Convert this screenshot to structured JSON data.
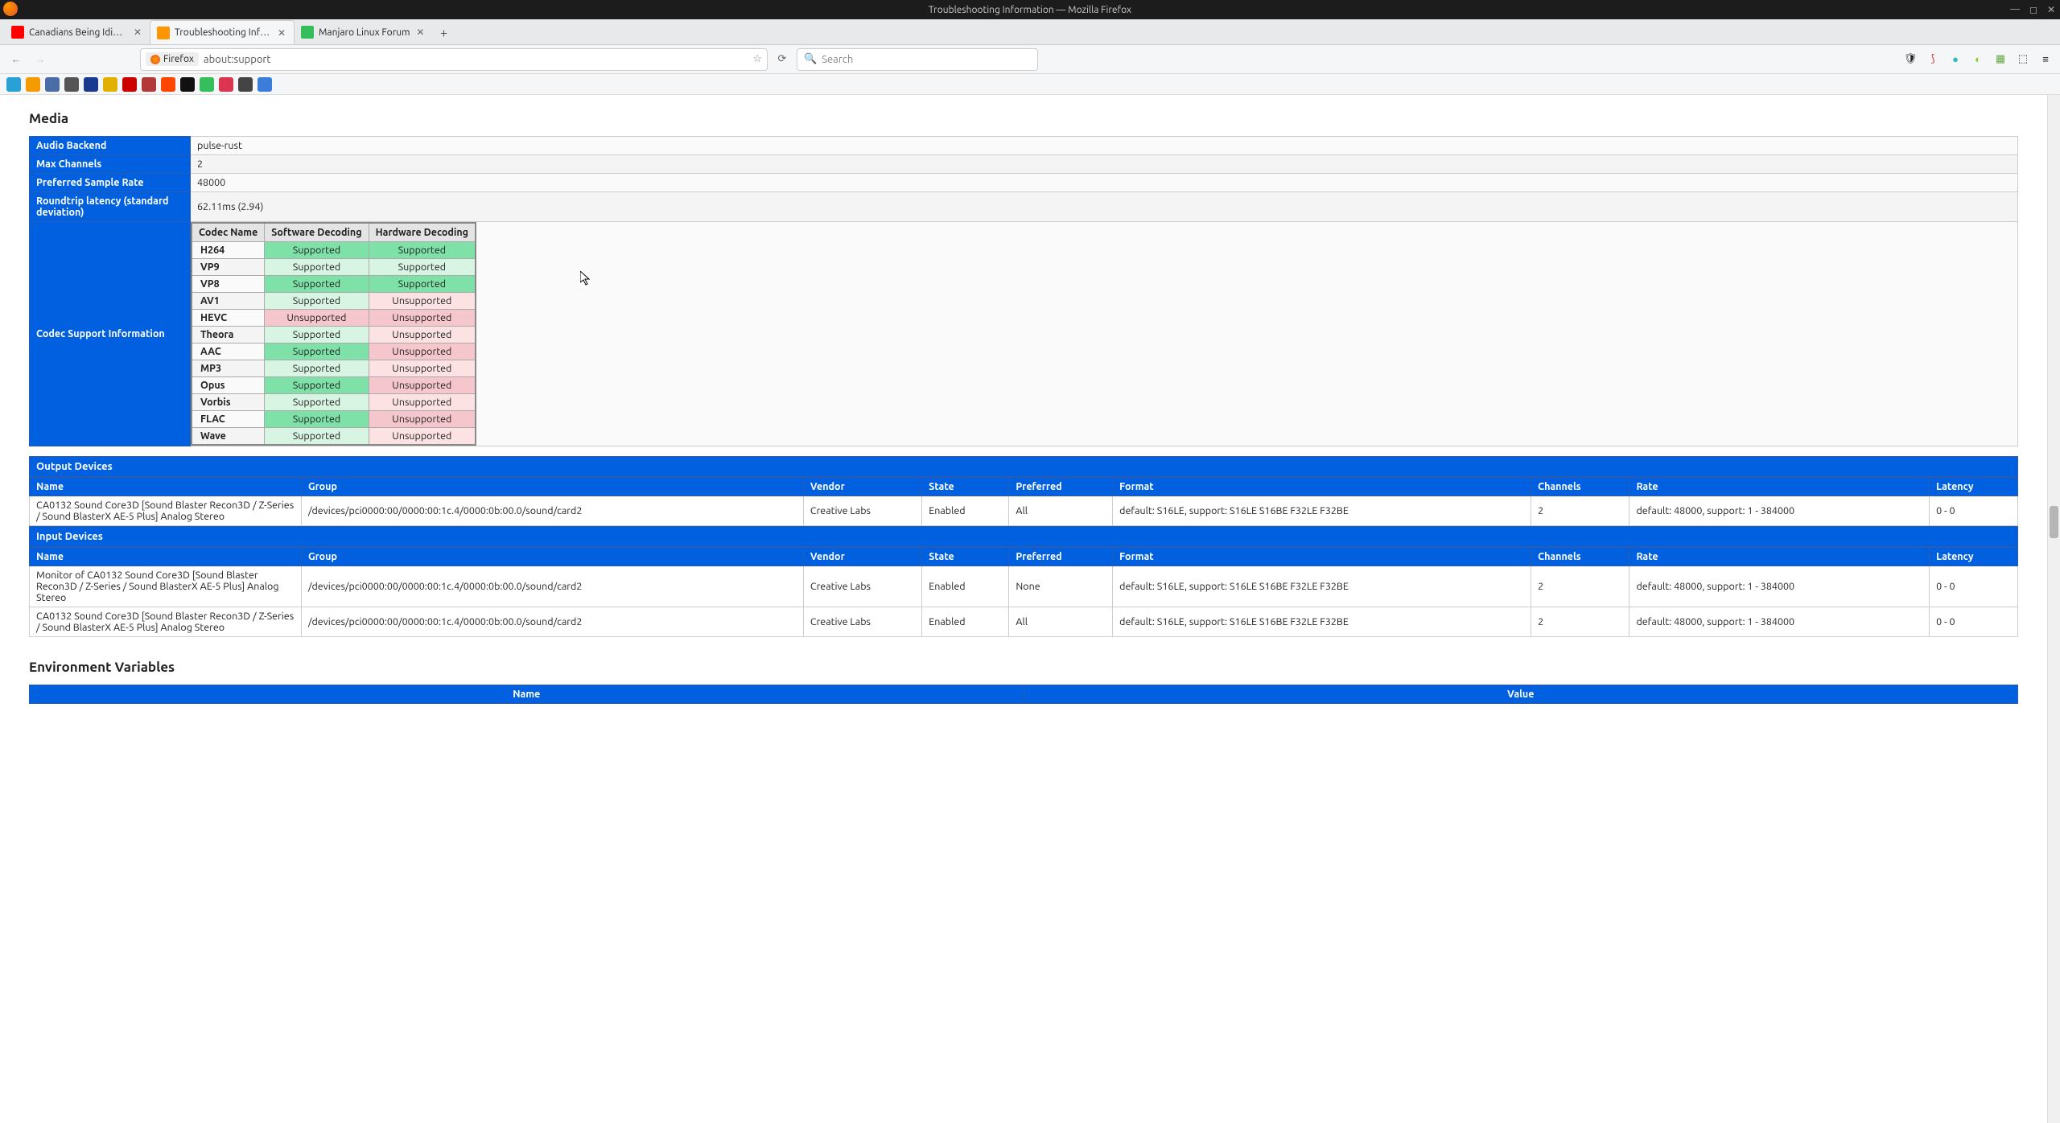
{
  "window_title": "Troubleshooting Information — Mozilla Firefox",
  "tabs": [
    {
      "label": "Canadians Being Idiots | F",
      "favicon_color": "#ff0000"
    },
    {
      "label": "Troubleshooting Informati",
      "favicon_color": "#ff9500",
      "active": true
    },
    {
      "label": "Manjaro Linux Forum",
      "favicon_color": "#35bf5c"
    }
  ],
  "urlbar": {
    "identity": "Firefox",
    "url": "about:support"
  },
  "searchbar": {
    "placeholder": "Search"
  },
  "bookmarks": [
    {
      "color": "#2aa1d6"
    },
    {
      "color": "#f59b00"
    },
    {
      "color": "#4a6da7"
    },
    {
      "color": "#555"
    },
    {
      "color": "#1a3a8f"
    },
    {
      "color": "#e2b100"
    },
    {
      "color": "#c00"
    },
    {
      "color": "#b33939"
    },
    {
      "color": "#ff4500"
    },
    {
      "color": "#111"
    },
    {
      "color": "#35bf5c"
    },
    {
      "color": "#db3552"
    },
    {
      "color": "#444"
    },
    {
      "color": "#3b7dd8"
    }
  ],
  "media": {
    "heading": "Media",
    "rows": {
      "audio_backend_label": "Audio Backend",
      "audio_backend_value": "pulse-rust",
      "max_channels_label": "Max Channels",
      "max_channels_value": "2",
      "sample_rate_label": "Preferred Sample Rate",
      "sample_rate_value": "48000",
      "latency_label": "Roundtrip latency (standard deviation)",
      "latency_value": "62.11ms (2.94)",
      "codec_label": "Codec Support Information"
    },
    "codec_headers": {
      "name": "Codec Name",
      "sw": "Software Decoding",
      "hw": "Hardware Decoding"
    },
    "codecs": [
      {
        "name": "H264",
        "sw": "Supported",
        "hw": "Supported"
      },
      {
        "name": "VP9",
        "sw": "Supported",
        "hw": "Supported"
      },
      {
        "name": "VP8",
        "sw": "Supported",
        "hw": "Supported"
      },
      {
        "name": "AV1",
        "sw": "Supported",
        "hw": "Unsupported"
      },
      {
        "name": "HEVC",
        "sw": "Unsupported",
        "hw": "Unsupported"
      },
      {
        "name": "Theora",
        "sw": "Supported",
        "hw": "Unsupported"
      },
      {
        "name": "AAC",
        "sw": "Supported",
        "hw": "Unsupported"
      },
      {
        "name": "MP3",
        "sw": "Supported",
        "hw": "Unsupported"
      },
      {
        "name": "Opus",
        "sw": "Supported",
        "hw": "Unsupported"
      },
      {
        "name": "Vorbis",
        "sw": "Supported",
        "hw": "Unsupported"
      },
      {
        "name": "FLAC",
        "sw": "Supported",
        "hw": "Unsupported"
      },
      {
        "name": "Wave",
        "sw": "Supported",
        "hw": "Unsupported"
      }
    ],
    "output_devices_label": "Output Devices",
    "input_devices_label": "Input Devices",
    "device_headers": {
      "name": "Name",
      "group": "Group",
      "vendor": "Vendor",
      "state": "State",
      "preferred": "Preferred",
      "format": "Format",
      "channels": "Channels",
      "rate": "Rate",
      "latency": "Latency"
    },
    "output_devices": [
      {
        "name": "CA0132 Sound Core3D [Sound Blaster Recon3D / Z-Series / Sound BlasterX AE-5 Plus] Analog Stereo",
        "group": "/devices/pci0000:00/0000:00:1c.4/0000:0b:00.0/sound/card2",
        "vendor": "Creative Labs",
        "state": "Enabled",
        "preferred": "All",
        "format": "default: S16LE, support: S16LE S16BE F32LE F32BE",
        "channels": "2",
        "rate": "default: 48000, support: 1 - 384000",
        "latency": "0 - 0"
      }
    ],
    "input_devices": [
      {
        "name": "Monitor of CA0132 Sound Core3D [Sound Blaster Recon3D / Z-Series / Sound BlasterX AE-5 Plus] Analog Stereo",
        "group": "/devices/pci0000:00/0000:00:1c.4/0000:0b:00.0/sound/card2",
        "vendor": "Creative Labs",
        "state": "Enabled",
        "preferred": "None",
        "format": "default: S16LE, support: S16LE S16BE F32LE F32BE",
        "channels": "2",
        "rate": "default: 48000, support: 1 - 384000",
        "latency": "0 - 0"
      },
      {
        "name": "CA0132 Sound Core3D [Sound Blaster Recon3D / Z-Series / Sound BlasterX AE-5 Plus] Analog Stereo",
        "group": "/devices/pci0000:00/0000:00:1c.4/0000:0b:00.0/sound/card2",
        "vendor": "Creative Labs",
        "state": "Enabled",
        "preferred": "All",
        "format": "default: S16LE, support: S16LE S16BE F32LE F32BE",
        "channels": "2",
        "rate": "default: 48000, support: 1 - 384000",
        "latency": "0 - 0"
      }
    ]
  },
  "env": {
    "heading": "Environment Variables",
    "headers": {
      "name": "Name",
      "value": "Value"
    }
  }
}
